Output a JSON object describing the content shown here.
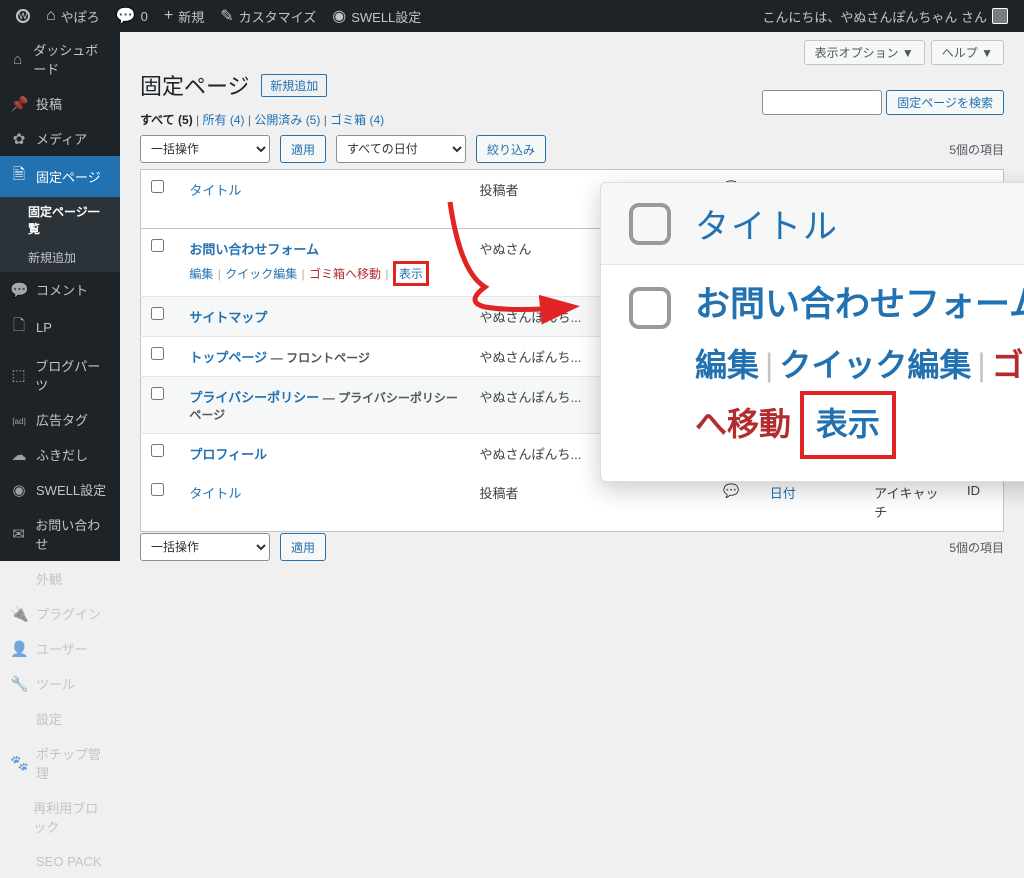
{
  "adminbar": {
    "site_name": "やぽろ",
    "comments": "0",
    "new": "新規",
    "customize": "カスタマイズ",
    "swell": "SWELL設定",
    "greeting": "こんにちは、やぬさんぽんちゃん さん"
  },
  "sidebar": {
    "items": [
      {
        "label": "ダッシュボード",
        "icon": "dashboard-icon",
        "glyph": "⌂"
      },
      {
        "label": "投稿",
        "icon": "posts-icon",
        "glyph": "📌"
      },
      {
        "label": "メディア",
        "icon": "media-icon",
        "glyph": "✿"
      },
      {
        "label": "固定ページ",
        "icon": "pages-icon",
        "glyph": "🗎",
        "current": true,
        "submenu": [
          {
            "label": "固定ページ一覧",
            "current": true
          },
          {
            "label": "新規追加"
          }
        ]
      },
      {
        "label": "コメント",
        "icon": "comments-icon",
        "glyph": "💬"
      },
      {
        "label": "LP",
        "icon": "lp-icon",
        "glyph": "🗋"
      },
      {
        "label": "ブログパーツ",
        "icon": "blogparts-icon",
        "glyph": "⬚"
      },
      {
        "label": "広告タグ",
        "icon": "adtag-icon",
        "glyph": "[ad]"
      },
      {
        "label": "ふきだし",
        "icon": "balloon-icon",
        "glyph": "☁"
      },
      {
        "label": "SWELL設定",
        "icon": "swell-icon",
        "glyph": "◉"
      },
      {
        "label": "お問い合わせ",
        "icon": "contact-icon",
        "glyph": "✉"
      },
      {
        "label": "外観",
        "icon": "appearance-icon",
        "glyph": "🖌"
      },
      {
        "label": "プラグイン",
        "icon": "plugins-icon",
        "glyph": "🔌"
      },
      {
        "label": "ユーザー",
        "icon": "users-icon",
        "glyph": "👤"
      },
      {
        "label": "ツール",
        "icon": "tools-icon",
        "glyph": "🔧"
      },
      {
        "label": "設定",
        "icon": "settings-icon",
        "glyph": "⚙"
      },
      {
        "label": "ポチップ管理",
        "icon": "pochipp-icon",
        "glyph": "🐾"
      },
      {
        "label": "再利用ブロック",
        "icon": "reusable-icon",
        "glyph": "↻"
      },
      {
        "label": "SEO PACK",
        "icon": "seopack-icon",
        "glyph": "☰"
      }
    ]
  },
  "screen": {
    "options": "表示オプション ▼",
    "help": "ヘルプ ▼"
  },
  "heading": "固定ページ",
  "add_new": "新規追加",
  "views": {
    "all": {
      "label": "すべて",
      "count": "(5)"
    },
    "mine": {
      "label": "所有",
      "count": "(4)"
    },
    "published": {
      "label": "公開済み",
      "count": "(5)"
    },
    "trash": {
      "label": "ゴミ箱",
      "count": "(4)"
    }
  },
  "search": {
    "submit": "固定ページを検索"
  },
  "bulk": {
    "select": "一括操作",
    "apply": "適用"
  },
  "filter": {
    "date": "すべての日付",
    "submit": "絞り込み"
  },
  "pagination": "5個の項目",
  "columns": {
    "title": "タイトル",
    "author": "投稿者",
    "date": "日付",
    "eyecatch": "アイキャッチ",
    "id": "ID"
  },
  "row_actions": {
    "edit": "編集",
    "quick_edit": "クイック編集",
    "trash": "ゴミ箱へ移動",
    "view": "表示"
  },
  "rows": [
    {
      "title": "お問い合わせフォーム",
      "author": "やぬさん",
      "show_actions": true
    },
    {
      "title": "サイトマップ",
      "author": "やぬさんぽんち..."
    },
    {
      "title": "トップページ",
      "state": "— フロントページ",
      "author": "やぬさんぽんち..."
    },
    {
      "title": "プライバシーポリシー",
      "state": "— プライバシーポリシーページ",
      "author": "やぬさんぽんち..."
    },
    {
      "title": "プロフィール",
      "author": "やぬさんぽんち..."
    }
  ],
  "zoom": {
    "title_label": "タイトル",
    "row_title": "お問い合わせフォーム",
    "edit": "編集",
    "quick_edit": "クイック編集",
    "trash": "ゴミ箱へ移動",
    "view": "表示"
  }
}
